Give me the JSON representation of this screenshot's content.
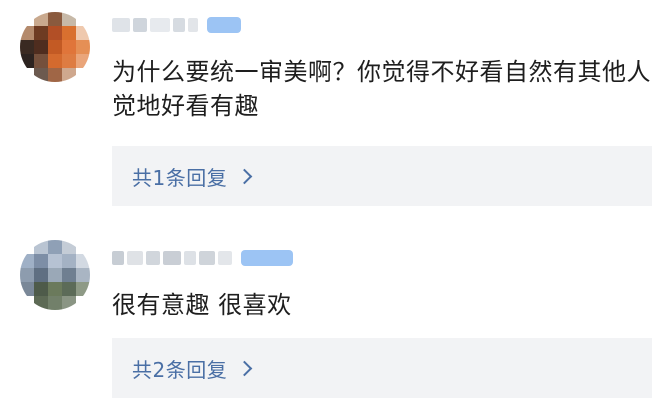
{
  "comments": [
    {
      "text": "为什么要统一审美啊？你觉得不好看自然有其他人觉地好看有趣",
      "reply_label": "共1条回复"
    },
    {
      "text": "很有意趣 很喜欢",
      "reply_label": "共2条回复"
    }
  ],
  "icons": {
    "reply_chevron": "chevron-right-icon",
    "avatar": "avatar-pixelated"
  },
  "colors": {
    "reply_text": "#4a6fa5",
    "reply_background": "#f2f3f5",
    "body_text": "#1e1e1e"
  }
}
